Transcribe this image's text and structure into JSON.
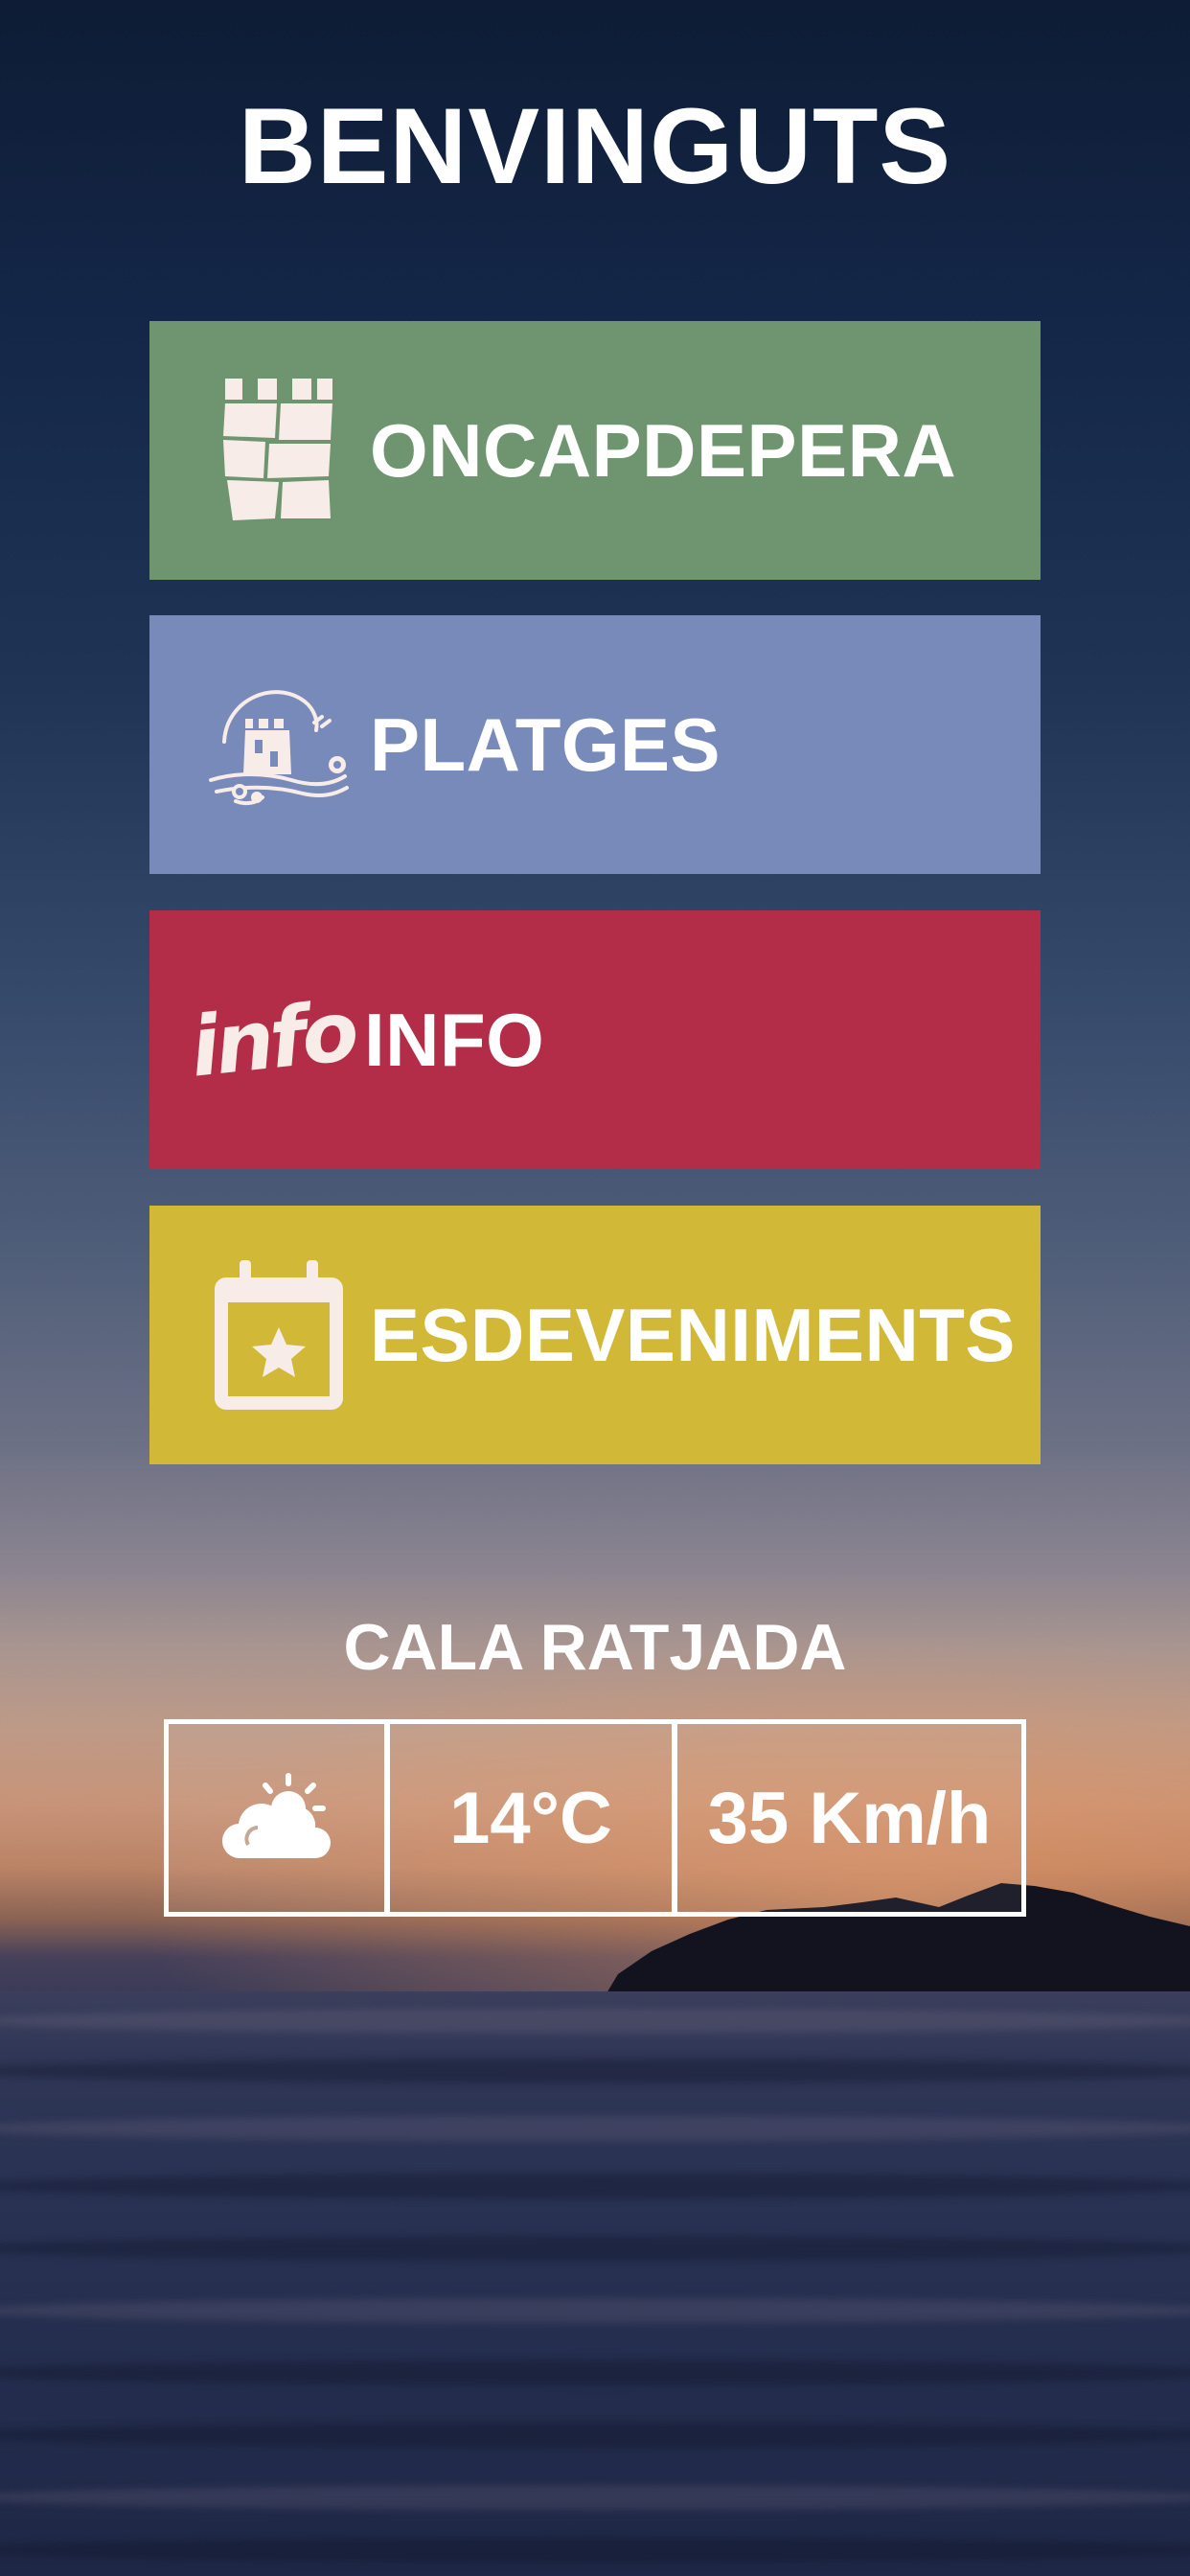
{
  "header": {
    "title": "BENVINGUTS"
  },
  "menu": {
    "items": [
      {
        "label": "ONCAPDEPERA",
        "icon": "castle-tower-icon",
        "color": "#6f9570"
      },
      {
        "label": "PLATGES",
        "icon": "beach-tower-icon",
        "color": "#788aba"
      },
      {
        "label": "INFO",
        "icon": "info-text-icon",
        "icon_text": "info",
        "color": "#b32d48"
      },
      {
        "label": "ESDEVENIMENTS",
        "icon": "calendar-star-icon",
        "color": "#d1b836"
      }
    ]
  },
  "weather": {
    "location": "CALA RATJADA",
    "condition_icon": "partly-cloudy-icon",
    "temperature": "14°C",
    "wind": "35 Km/h"
  },
  "colors": {
    "text": "#ffffff"
  }
}
